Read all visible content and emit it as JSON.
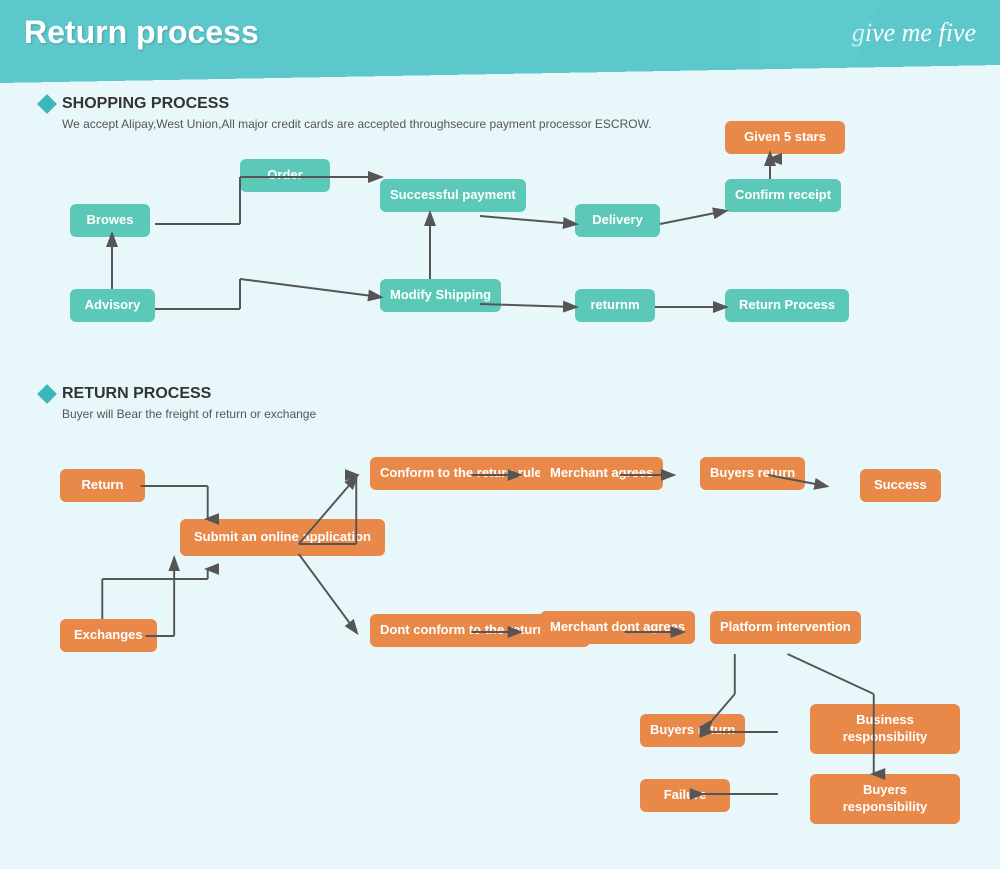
{
  "header": {
    "title": "Return process",
    "logo": "give me five"
  },
  "shopping": {
    "heading": "SHOPPING PROCESS",
    "sub": "We accept Alipay,West Union,All major credit cards are accepted throughsecure payment processor ESCROW.",
    "boxes": {
      "browes": "Browes",
      "order": "Order",
      "payment": "Successful payment",
      "delivery": "Delivery",
      "confirm": "Confirm receipt",
      "given5": "Given 5 stars",
      "advisory": "Advisory",
      "modify": "Modify Shipping",
      "returnm": "returnm",
      "returnp": "Return Process"
    }
  },
  "returns": {
    "heading": "RETURN PROCESS",
    "sub": "Buyer will Bear the freight of return or exchange",
    "boxes": {
      "return": "Return",
      "submit": "Submit an online application",
      "conform": "Conform to the return rules",
      "merchant_agrees": "Merchant agrees",
      "buyers_return1": "Buyers return",
      "success": "Success",
      "exchanges": "Exchanges",
      "dont_conform": "Dont conform to the return rules",
      "merchant_dont": "Merchant dont agrees",
      "platform": "Platform intervention",
      "buyers_return2": "Buyers return",
      "business": "Business responsibility",
      "failure": "Failure",
      "buyers_resp": "Buyers responsibility"
    }
  }
}
